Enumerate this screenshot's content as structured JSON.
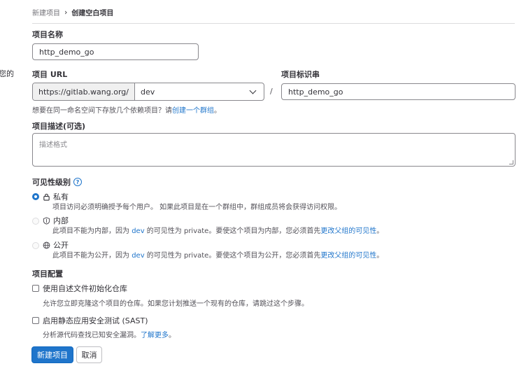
{
  "left_fragment": "您的",
  "breadcrumb": {
    "parent": "新建项目",
    "separator": "›",
    "current": "创建空白项目"
  },
  "project_name": {
    "label": "项目名称",
    "value": "http_demo_go"
  },
  "project_url": {
    "label": "项目 URL",
    "prefix": "https://gitlab.wang.org/",
    "namespace": "dev",
    "separator": "/"
  },
  "project_slug": {
    "label": "项目标识串",
    "value": "http_demo_go"
  },
  "group_help": {
    "text": "想要在同一命名空间下存放几个依赖项目？请",
    "link": "创建一个群组",
    "suffix": "。"
  },
  "description": {
    "label": "项目描述(可选)",
    "placeholder": "描述格式"
  },
  "visibility": {
    "label": "可见性级别",
    "help_icon": "?",
    "options": [
      {
        "icon": "lock-icon",
        "title": "私有",
        "desc": "项目访问必须明确授予每个用户。 如果此项目是在一个群组中，群组成员将会获得访问权限。",
        "selected": true,
        "disabled": false
      },
      {
        "icon": "shield-icon",
        "title": "内部",
        "desc_pre": "此项目不能为内部，因为",
        "desc_group": "dev",
        "desc_mid": "的可见性为 private。要使这个项目为内部，您必须首先",
        "desc_link": "更改父组的可见性",
        "desc_end": "。",
        "selected": false,
        "disabled": true
      },
      {
        "icon": "globe-icon",
        "title": "公开",
        "desc_pre": "此项目不能为公开，因为",
        "desc_group": "dev",
        "desc_mid": "的可见性为 private。要使这个项目为公开，您必须首先",
        "desc_link": "更改父组的可见性",
        "desc_end": "。",
        "selected": false,
        "disabled": true
      }
    ]
  },
  "config": {
    "label": "项目配置",
    "readme": {
      "label": "使用自述文件初始化仓库",
      "desc": "允许您立即克隆这个项目的仓库。如果您计划推送一个现有的仓库，请跳过这个步骤。",
      "checked": false
    },
    "sast": {
      "label": "启用静态应用安全测试 (SAST)",
      "desc": "分析源代码查找已知安全漏洞。",
      "link": "了解更多",
      "link_suffix": "。",
      "checked": false
    }
  },
  "buttons": {
    "create": "新建项目",
    "cancel": "取消"
  },
  "colors": {
    "primary": "#1f75cb",
    "text": "#333238",
    "border": "#89888d"
  }
}
